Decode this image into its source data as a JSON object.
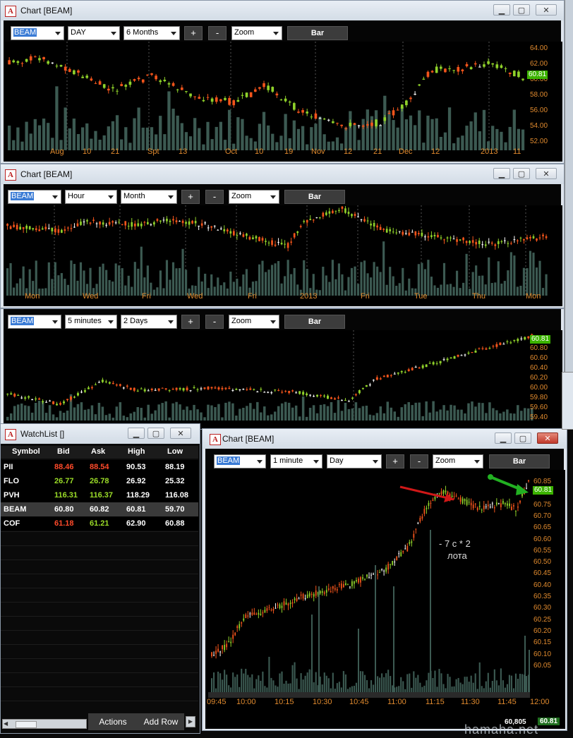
{
  "chart1": {
    "title": "Chart [BEAM]",
    "symbol": "BEAM",
    "interval": "DAY",
    "period": "6 Months",
    "plus": "+",
    "minus": "-",
    "zoom": "Zoom",
    "bar": "Bar",
    "y_labels": [
      "64.00",
      "62.00",
      "60.00",
      "58.00",
      "56.00",
      "54.00",
      "52.00"
    ],
    "last": "60.81",
    "x_labels": [
      "Aug",
      "10",
      "21",
      "Spt",
      "13",
      "Oct",
      "10",
      "19",
      "Nov",
      "12",
      "21",
      "Dec",
      "12",
      "2013",
      "11"
    ]
  },
  "chart2": {
    "title": "Chart [BEAM]",
    "symbol": "BEAM",
    "interval": "Hour",
    "period": "Month",
    "plus": "+",
    "minus": "-",
    "zoom": "Zoom",
    "bar": "Bar",
    "x_labels": [
      "Mon",
      "Wed",
      "Fri",
      "Wed",
      "Fri",
      "2013",
      "Fri",
      "Tue",
      "Thu",
      "Mon"
    ]
  },
  "chart3": {
    "symbol": "BEAM",
    "interval": "5 minutes",
    "period": "2 Days",
    "plus": "+",
    "minus": "-",
    "zoom": "Zoom",
    "bar": "Bar",
    "y_labels": [
      "60.80",
      "60.60",
      "60.40",
      "60.20",
      "60.00",
      "59.80",
      "59.60",
      "59.40"
    ],
    "last": "60.81"
  },
  "watchlist": {
    "title": "WatchList []",
    "columns": [
      "Symbol",
      "Bid",
      "Ask",
      "High",
      "Low"
    ],
    "rows": [
      {
        "symbol": "PII",
        "bid": "88.46",
        "ask": "88.54",
        "high": "90.53",
        "low": "88.19",
        "bid_color": "#ff4a2a",
        "ask_color": "#ff4a2a"
      },
      {
        "symbol": "FLO",
        "bid": "26.77",
        "ask": "26.78",
        "high": "26.92",
        "low": "25.32",
        "bid_color": "#9bdc28",
        "ask_color": "#9bdc28"
      },
      {
        "symbol": "PVH",
        "bid": "116.31",
        "ask": "116.37",
        "high": "118.29",
        "low": "116.08",
        "bid_color": "#9bdc28",
        "ask_color": "#9bdc28"
      },
      {
        "symbol": "BEAM",
        "bid": "60.80",
        "ask": "60.82",
        "high": "60.81",
        "low": "59.70",
        "bid_color": "#ffffff",
        "ask_color": "#ffffff"
      },
      {
        "symbol": "COF",
        "bid": "61.18",
        "ask": "61.21",
        "high": "62.90",
        "low": "60.88",
        "bid_color": "#ff4a2a",
        "ask_color": "#9bdc28"
      }
    ],
    "actions": "Actions",
    "add_row": "Add Row"
  },
  "chart4": {
    "title": "Chart [BEAM]",
    "symbol": "BEAM",
    "interval": "1 minute",
    "period": "Day",
    "plus": "+",
    "minus": "-",
    "zoom": "Zoom",
    "bar": "Bar",
    "y_labels": [
      "60.85",
      "60.80",
      "60.75",
      "60.70",
      "60.65",
      "60.60",
      "60.55",
      "60.50",
      "60.45",
      "60.40",
      "60.35",
      "60.30",
      "60.25",
      "60.20",
      "60.15",
      "60.10",
      "60.05"
    ],
    "last": "60.81",
    "x_labels": [
      "09:45",
      "10:00",
      "10:15",
      "10:30",
      "10:45",
      "11:00",
      "11:15",
      "11:30",
      "11:45",
      "12:00"
    ],
    "status_price": "60,805",
    "status_last": "60.81",
    "annotation_line1": "- 7 с * 2",
    "annotation_line2": "лота"
  },
  "watermark": "hamaha.net"
}
